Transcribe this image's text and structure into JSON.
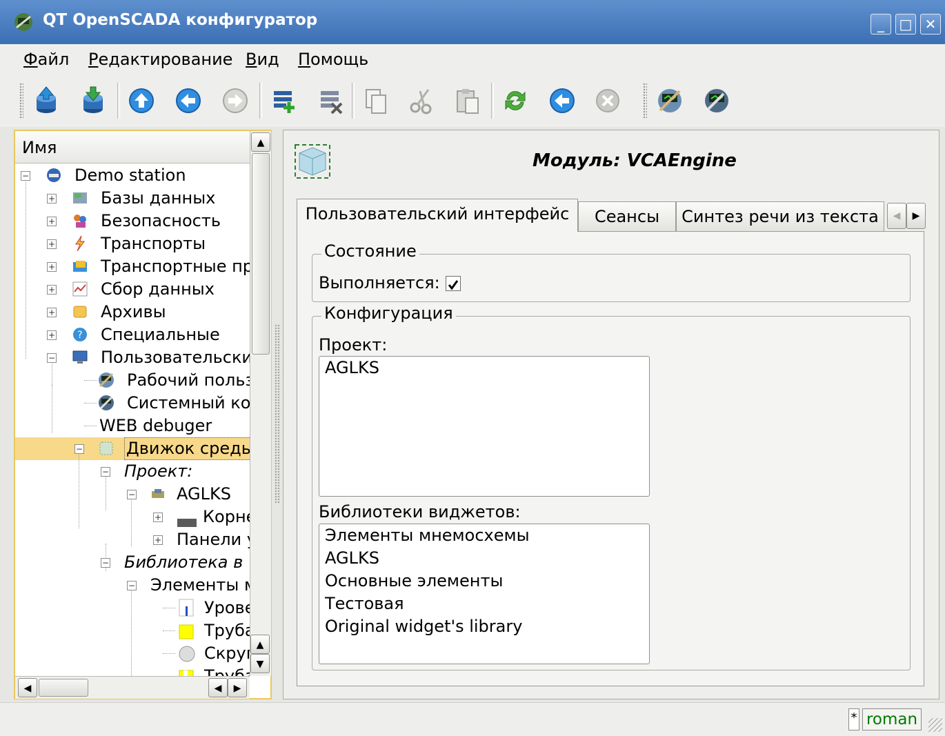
{
  "window": {
    "title": "QT OpenSCADA конфигуратор",
    "controls": [
      "minimize-icon",
      "maximize-icon",
      "close-icon"
    ]
  },
  "menu": {
    "items": [
      {
        "label": "Файл"
      },
      {
        "label": "Редактирование"
      },
      {
        "label": "Вид"
      },
      {
        "label": "Помощь"
      }
    ]
  },
  "toolbar": {
    "buttons": [
      {
        "icon": "db-load-icon"
      },
      {
        "icon": "db-save-icon"
      },
      {
        "icon": "arrow-up-icon"
      },
      {
        "icon": "arrow-back-icon"
      },
      {
        "icon": "arrow-forward-icon"
      },
      {
        "icon": "item-add-icon"
      },
      {
        "icon": "item-delete-icon"
      },
      {
        "icon": "copy-icon"
      },
      {
        "icon": "cut-icon"
      },
      {
        "icon": "paste-icon"
      },
      {
        "icon": "refresh-icon"
      },
      {
        "icon": "start-icon"
      },
      {
        "icon": "stop-icon"
      },
      {
        "icon": "user-interface-icon"
      },
      {
        "icon": "system-configurator-icon"
      }
    ]
  },
  "tree": {
    "header": "Имя",
    "rows": [
      {
        "label": "Demo station"
      },
      {
        "label": "Базы данных"
      },
      {
        "label": "Безопасность"
      },
      {
        "label": "Транспорты"
      },
      {
        "label": "Транспортные пр"
      },
      {
        "label": "Сбор данных"
      },
      {
        "label": "Архивы"
      },
      {
        "label": "Специальные"
      },
      {
        "label": "Пользовательские"
      },
      {
        "label": "Рабочий польз"
      },
      {
        "label": "Системный ко"
      },
      {
        "label": "WEB debuger"
      },
      {
        "label": "Движок среды"
      },
      {
        "label": "Проект:"
      },
      {
        "label": "AGLKS"
      },
      {
        "label": "Корне"
      },
      {
        "label": "Панели у"
      },
      {
        "label": "Библиотека в"
      },
      {
        "label": "Элементы м"
      },
      {
        "label": "Урове"
      },
      {
        "label": "Труба"
      },
      {
        "label": "Скруг"
      },
      {
        "label": "Труба"
      }
    ],
    "selected": "Движок среды"
  },
  "main": {
    "title": "Модуль: VCAEngine",
    "tabs": [
      {
        "label": "Пользовательский интерфейс"
      },
      {
        "label": "Сеансы"
      },
      {
        "label": "Синтез речи из текста"
      }
    ],
    "state_group": {
      "title": "Состояние",
      "running_label": "Выполняется:",
      "running_checked": true
    },
    "config_group": {
      "title": "Конфигурация",
      "project_label": "Проект:",
      "projects": [
        "AGLKS"
      ],
      "libraries_label": "Библиотеки виджетов:",
      "libraries": [
        "Элементы мнемосхемы",
        "AGLKS",
        "Основные элементы",
        "Тестовая",
        "Original widget's library"
      ]
    }
  },
  "status": {
    "modified_marker": "*",
    "user": "roman",
    "user_color": "#007a00"
  }
}
